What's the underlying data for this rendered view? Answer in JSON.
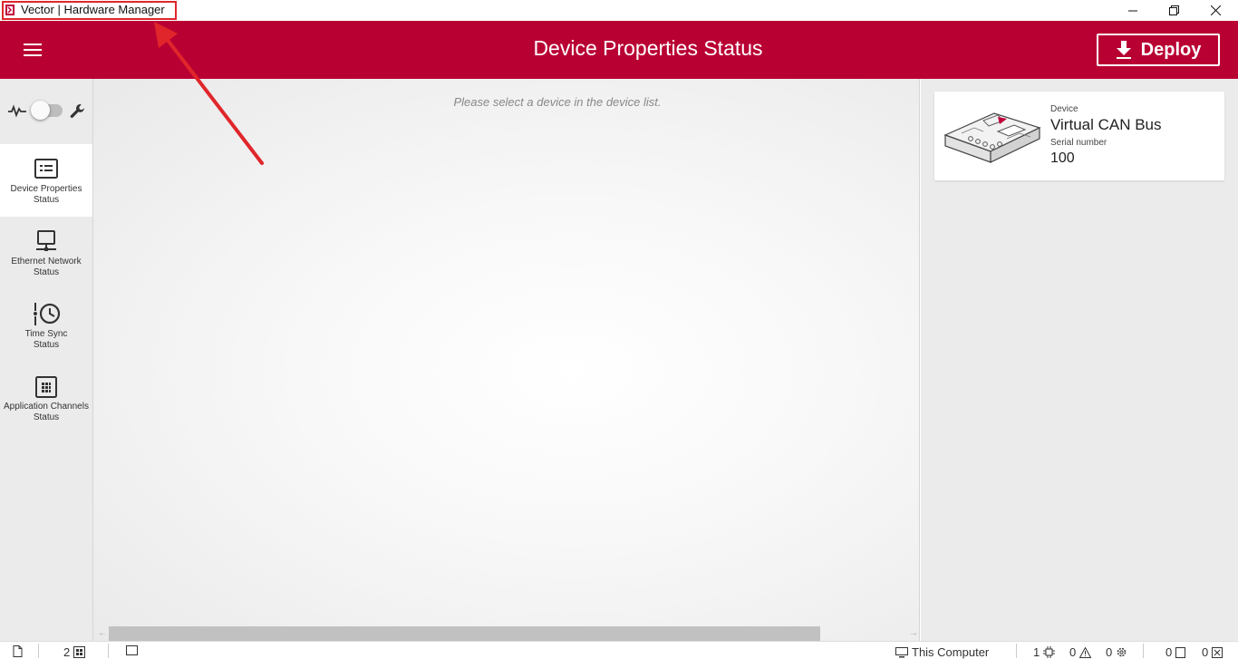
{
  "window": {
    "title": "Vector | Hardware Manager",
    "minimize_glyph": "—",
    "maximize_glyph": "❐",
    "close_glyph": "✕"
  },
  "header": {
    "title": "Device Properties Status",
    "deploy_label": "Deploy",
    "menu_icon": "hamburger-menu-icon",
    "color": "#b90033"
  },
  "mode_switch": {
    "left_icon": "pulse-icon",
    "right_icon": "wrench-icon",
    "state": "off"
  },
  "sidebar": {
    "items": [
      {
        "label_line1": "Device Properties",
        "label_line2": "Status",
        "icon": "device-properties-icon",
        "active": true
      },
      {
        "label_line1": "Ethernet Network",
        "label_line2": "Status",
        "icon": "monitor-icon",
        "active": false
      },
      {
        "label_line1": "Time Sync",
        "label_line2": "Status",
        "icon": "clock-icon",
        "active": false
      },
      {
        "label_line1": "Application Channels",
        "label_line2": "Status",
        "icon": "grid-icon",
        "active": false
      }
    ]
  },
  "main": {
    "empty_message": "Please select a device in the device list."
  },
  "device_list": {
    "devices": [
      {
        "device_label": "Device",
        "name": "Virtual CAN Bus",
        "serial_label": "Serial number",
        "serial": "100",
        "image": "can-device-image"
      }
    ]
  },
  "statusbar": {
    "doc_count": "2",
    "location": "This Computer",
    "devices_count": "1",
    "warnings_count": "0",
    "settings_count": "0",
    "item_a_count": "0",
    "item_b_count": "0"
  },
  "colors": {
    "accent": "#b90033",
    "annotation": "#e0262b"
  }
}
